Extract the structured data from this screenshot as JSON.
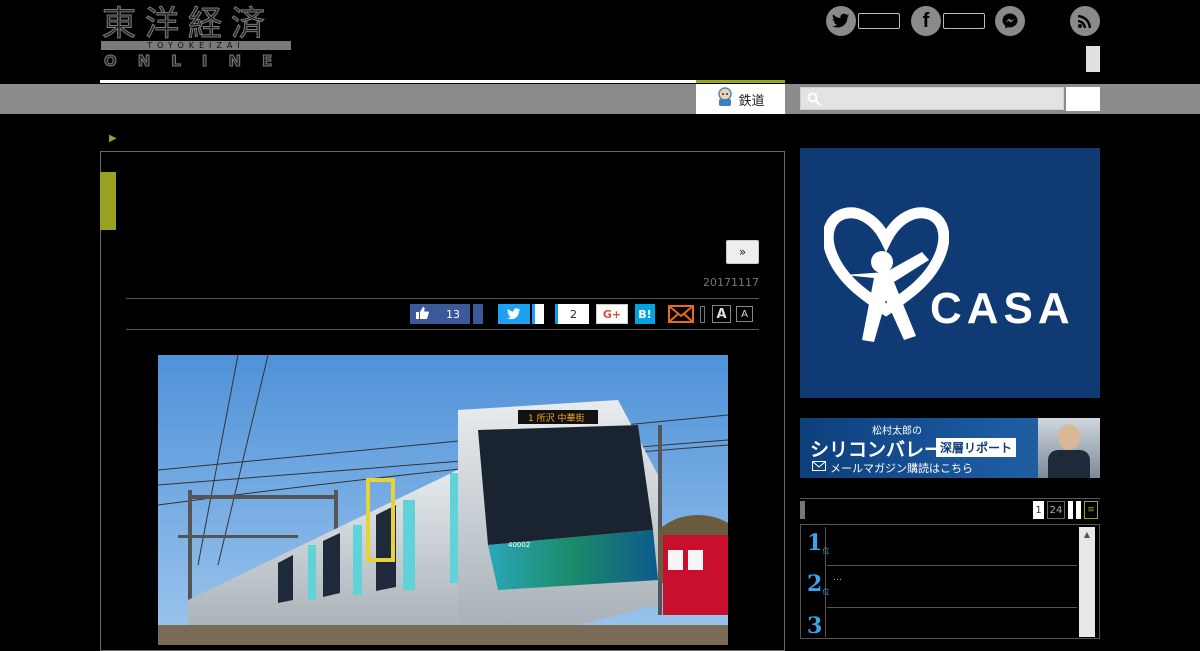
{
  "header": {
    "logo_kanji": "東洋経済",
    "logo_romaji": "TOYOKEIZAI",
    "logo_online": "ONLINE",
    "social_icons": [
      "twitter-icon",
      "facebook-icon",
      "messenger-icon",
      "rss-icon"
    ]
  },
  "nav": {
    "tab_label": "鉄道",
    "search_placeholder": ""
  },
  "article": {
    "breadcrumb_marker": "▶",
    "more_button": "»",
    "date": "20171117",
    "share": {
      "like_count": "13",
      "hatena_count": "2",
      "gplus_label": "G+",
      "hatena_label": "B!",
      "font_large": "A",
      "font_small": "A"
    },
    "photo_display": "1 所沢 中華街",
    "photo_car_number": "40002"
  },
  "sidebar": {
    "ad1_brand": "CASA",
    "ad1_mark": "®",
    "ad2_line1": "松村太郎の",
    "ad2_line2": "シリコンバレー",
    "ad2_tag": "深層リポート",
    "ad2_line3": "メールマガジン購読はこちら",
    "ranking_tabs": [
      "1",
      "24",
      "",
      ""
    ],
    "ranking_items": [
      {
        "rank": "1",
        "suffix": "位",
        "text": ""
      },
      {
        "rank": "2",
        "suffix": "位",
        "text": "…"
      },
      {
        "rank": "3",
        "suffix": "位",
        "text": ""
      }
    ]
  },
  "colors": {
    "accent_green": "#98a21f",
    "nav_gray": "#8b8b8b",
    "twitter_blue": "#1da1f2",
    "facebook_blue": "#3b5998",
    "hatena_blue": "#00a4de",
    "rank_blue": "#3aa4e8",
    "ad_navy": "#0f3a74"
  }
}
